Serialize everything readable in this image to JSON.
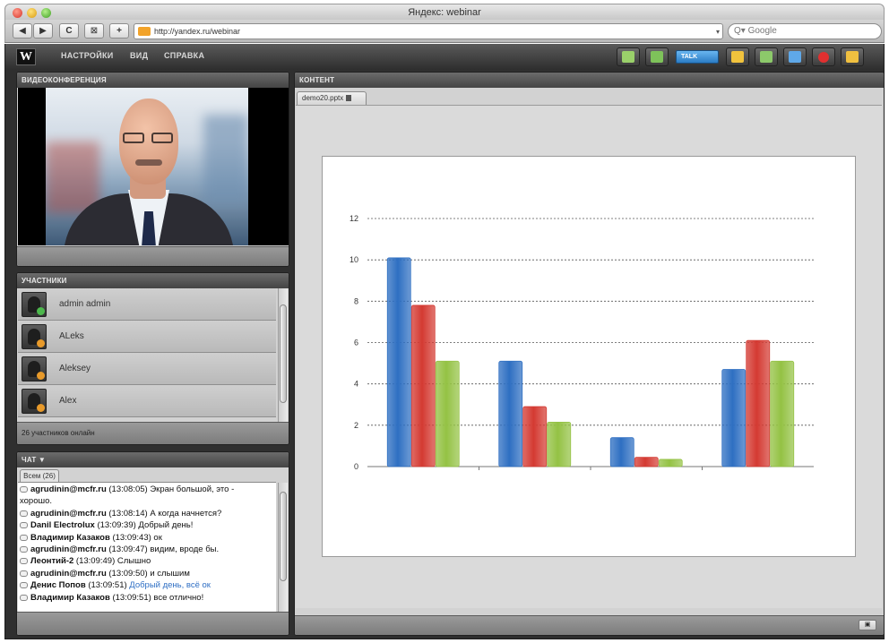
{
  "window": {
    "title": "Яндекс: webinar"
  },
  "browser": {
    "url": "http://yandex.ru/webinar",
    "search_placeholder": "Q▾ Google",
    "back_label": "◀",
    "forward_label": "▶",
    "reload_label": "C",
    "bookmark_label": "⊠",
    "add_label": "+"
  },
  "toolbar": {
    "logo": "W",
    "menu": [
      "НАСТРОЙКИ",
      "ВИД",
      "СПРАВКА"
    ],
    "talk_label": "TALK",
    "tools": [
      {
        "icon": "webcam-icon",
        "color": "#9ad06a"
      },
      {
        "icon": "microphone-icon",
        "color": "#7ec25a"
      },
      {
        "icon": "presentation-icon",
        "color": "#f1c33d"
      },
      {
        "icon": "users-icon",
        "color": "#8cc96a"
      },
      {
        "icon": "desktop-share-icon",
        "color": "#5fa8e8"
      },
      {
        "icon": "record-icon",
        "color": "#e03030"
      },
      {
        "icon": "chat-icon",
        "color": "#f0c040"
      }
    ]
  },
  "video_panel": {
    "title": "ВИДЕОКОНФЕРЕНЦИЯ"
  },
  "participants_panel": {
    "title": "УЧАСТНИКИ",
    "items": [
      {
        "name": "admin admin",
        "badge_color": "#4db84d"
      },
      {
        "name": "ALeks",
        "badge_color": "#e89a2a"
      },
      {
        "name": "Aleksey",
        "badge_color": "#e89a2a"
      },
      {
        "name": "Alex",
        "badge_color": "#e89a2a"
      }
    ],
    "online_text": "26 участников онлайн"
  },
  "chat_panel": {
    "title": "ЧАТ ▼",
    "tab": "Всем (26)",
    "messages": [
      {
        "user": "agrudinin@mcfr.ru",
        "time": "(13:08:05)",
        "text": "Экран большой, это -",
        "highlight": false
      },
      {
        "user": "",
        "time": "",
        "text": "хорошо.",
        "highlight": false
      },
      {
        "user": "agrudinin@mcfr.ru",
        "time": "(13:08:14)",
        "text": "А когда начнется?",
        "highlight": false
      },
      {
        "user": "Danil Electrolux",
        "time": "(13:09:39)",
        "text": "Добрый день!",
        "highlight": false
      },
      {
        "user": "Владимир Казаков",
        "time": "(13:09:43)",
        "text": "ок",
        "highlight": false
      },
      {
        "user": "agrudinin@mcfr.ru",
        "time": "(13:09:47)",
        "text": "видим, вроде бы.",
        "highlight": false
      },
      {
        "user": "Леонтий-2",
        "time": "(13:09:49)",
        "text": "Слышно",
        "highlight": false
      },
      {
        "user": "agrudinin@mcfr.ru",
        "time": "(13:09:50)",
        "text": "и слышим",
        "highlight": false
      },
      {
        "user": "Денис Попов",
        "time": "(13:09:51)",
        "text": "Добрый день, всё ок",
        "highlight": true
      },
      {
        "user": "Владимир Казаков",
        "time": "(13:09:51)",
        "text": "все отлично!",
        "highlight": false
      }
    ]
  },
  "content_panel": {
    "title": "КОНТЕНТ",
    "tab": "demo20.pptx"
  },
  "chart_data": {
    "type": "bar",
    "categories": [
      "",
      "",
      "",
      ""
    ],
    "series": [
      {
        "values": [
          10.1,
          5.1,
          1.4,
          4.7
        ],
        "color": "#2e6fc2"
      },
      {
        "values": [
          7.8,
          2.9,
          0.45,
          6.1
        ],
        "color": "#d43a32"
      },
      {
        "values": [
          5.1,
          2.15,
          0.35,
          5.1
        ],
        "color": "#94c244"
      }
    ],
    "ylim": [
      0,
      12
    ],
    "yticks": [
      0,
      2,
      4,
      6,
      8,
      10,
      12
    ],
    "grid": true,
    "title": "",
    "xlabel": "",
    "ylabel": ""
  }
}
